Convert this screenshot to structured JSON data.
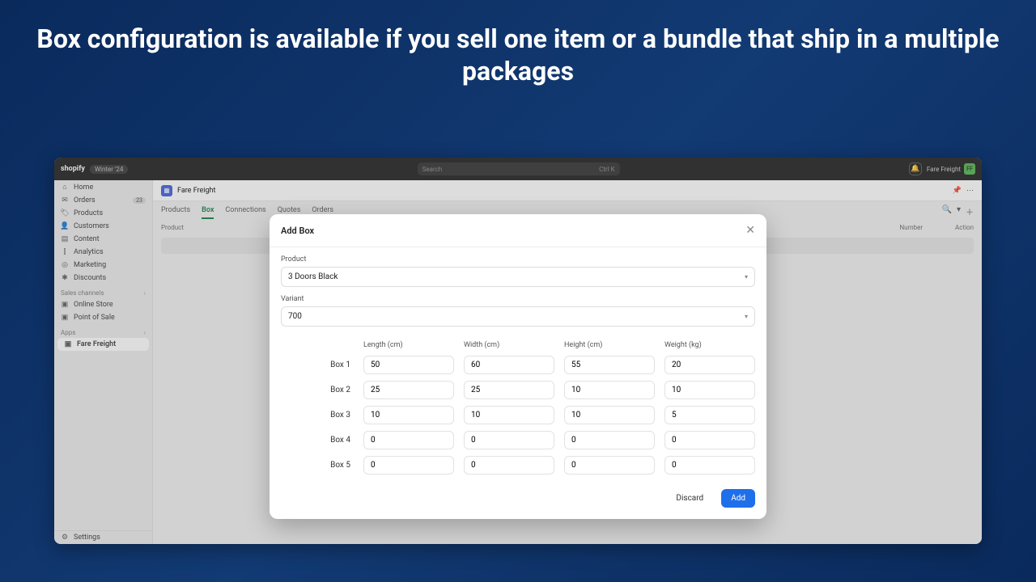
{
  "hero": "Box configuration is available if you sell one item or a bundle that ship in a multiple packages",
  "topbar": {
    "brand": "shopify",
    "badge": "Winter '24",
    "search_placeholder": "Search",
    "shortcut": "Ctrl K",
    "profile_name": "Fare Freight",
    "profile_initials": "FF"
  },
  "sidebar": {
    "primary": [
      {
        "icon": "⌂",
        "label": "Home"
      },
      {
        "icon": "✉",
        "label": "Orders",
        "badge": "23"
      },
      {
        "icon": "🏷",
        "label": "Products"
      },
      {
        "icon": "👤",
        "label": "Customers"
      },
      {
        "icon": "▤",
        "label": "Content"
      },
      {
        "icon": "⫿",
        "label": "Analytics"
      },
      {
        "icon": "◎",
        "label": "Marketing"
      },
      {
        "icon": "✱",
        "label": "Discounts"
      }
    ],
    "channels_label": "Sales channels",
    "channels": [
      {
        "icon": "▣",
        "label": "Online Store"
      },
      {
        "icon": "▣",
        "label": "Point of Sale"
      }
    ],
    "apps_label": "Apps",
    "apps": [
      {
        "icon": "▣",
        "label": "Fare Freight",
        "active": true
      }
    ],
    "settings": {
      "icon": "⚙",
      "label": "Settings"
    }
  },
  "page": {
    "title": "Fare Freight",
    "tabs": [
      "Products",
      "Box",
      "Connections",
      "Quotes",
      "Orders"
    ],
    "active_tab": "Box",
    "table_headers": {
      "left": "Product",
      "right_number": "Number",
      "right_action": "Action"
    }
  },
  "modal": {
    "title": "Add Box",
    "product_label": "Product",
    "product_value": "3 Doors Black",
    "variant_label": "Variant",
    "variant_value": "700",
    "columns": [
      "Length (cm)",
      "Width (cm)",
      "Height (cm)",
      "Weight (kg)"
    ],
    "rows": [
      {
        "name": "Box 1",
        "values": [
          "50",
          "60",
          "55",
          "20"
        ]
      },
      {
        "name": "Box 2",
        "values": [
          "25",
          "25",
          "10",
          "10"
        ]
      },
      {
        "name": "Box 3",
        "values": [
          "10",
          "10",
          "10",
          "5"
        ]
      },
      {
        "name": "Box 4",
        "values": [
          "0",
          "0",
          "0",
          "0"
        ]
      },
      {
        "name": "Box 5",
        "values": [
          "0",
          "0",
          "0",
          "0"
        ]
      }
    ],
    "discard": "Discard",
    "add": "Add"
  }
}
